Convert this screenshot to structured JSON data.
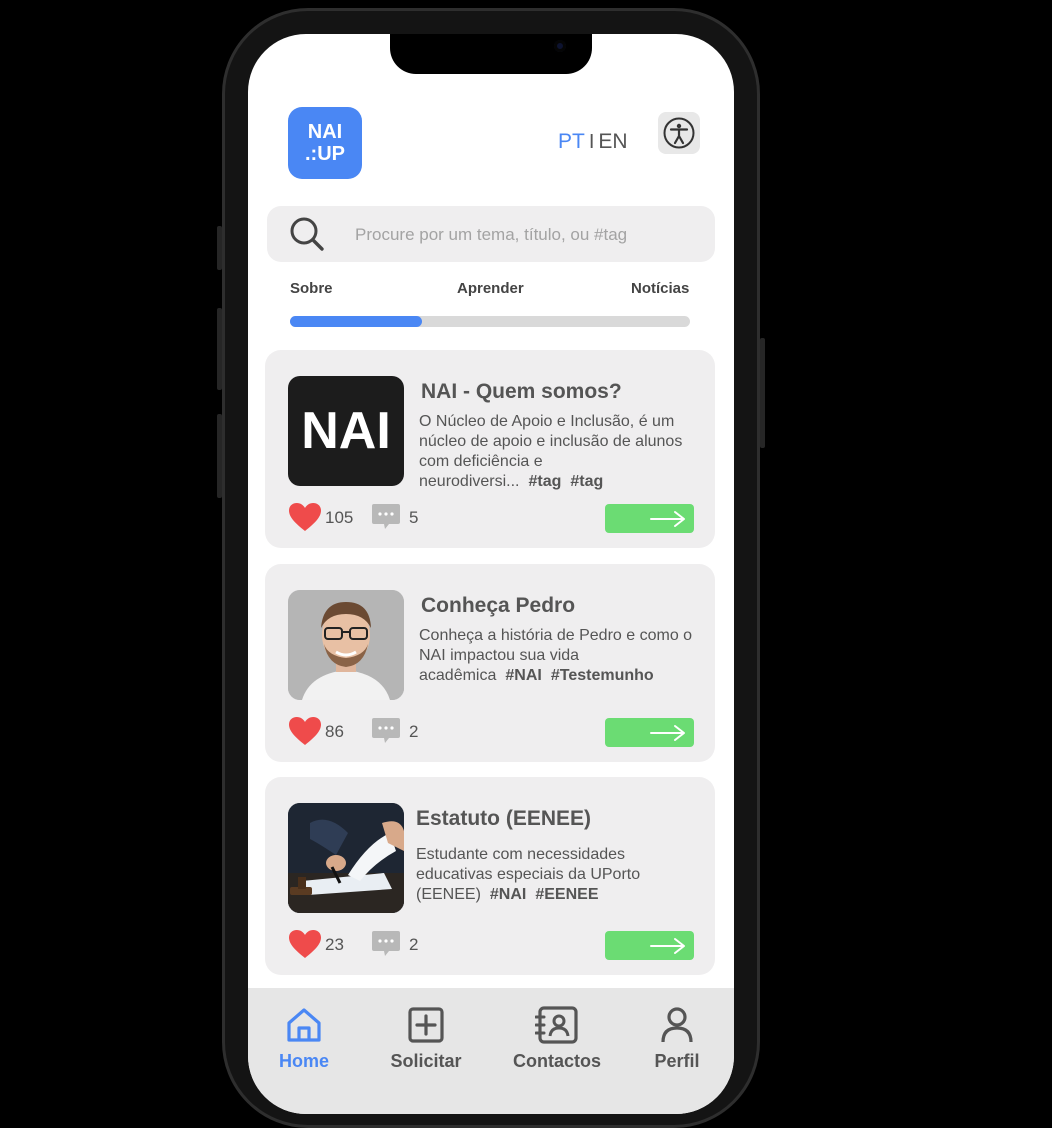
{
  "brand": {
    "logo_line1": "NAI",
    "logo_line2": ".:UP",
    "accent_color": "#4a87f4",
    "action_color": "#6bdc73"
  },
  "language": {
    "selected": "PT",
    "separator": "I",
    "other": "EN"
  },
  "accessibility": {
    "icon": "accessibility-icon"
  },
  "search": {
    "icon": "search-icon",
    "placeholder": "Procure por um tema, título, ou #tag",
    "value": ""
  },
  "tabs": [
    {
      "label": "Sobre"
    },
    {
      "label": "Aprender"
    },
    {
      "label": "Notícias"
    }
  ],
  "tab_progress": 0.33,
  "cards": [
    {
      "thumb_text": "NAI",
      "title": "NAI - Quem somos?",
      "description": "O Núcleo de Apoio e Inclusão, é um núcleo de apoio e inclusão de alunos com deficiência e neurodiversi...",
      "tags": [
        "#tag",
        "#tag"
      ],
      "likes": "105",
      "comments": "5"
    },
    {
      "thumb_text": "",
      "title": "Conheça Pedro",
      "description": "Conheça a história de Pedro e como o NAI impactou sua vida acadêmica",
      "tags": [
        "#NAI",
        "#Testemunho"
      ],
      "likes": "86",
      "comments": "2"
    },
    {
      "thumb_text": "",
      "title": "Estatuto (EENEE)",
      "description": "Estudante com necessidades educativas especiais da UPorto (EENEE)",
      "tags": [
        "#NAI",
        "#EENEE"
      ],
      "likes": "23",
      "comments": "2"
    }
  ],
  "bottom_nav": [
    {
      "label": "Home",
      "icon": "home-icon",
      "active": true
    },
    {
      "label": "Solicitar",
      "icon": "add-square-icon",
      "active": false
    },
    {
      "label": "Contactos",
      "icon": "contacts-book-icon",
      "active": false
    },
    {
      "label": "Perfil",
      "icon": "user-icon",
      "active": false
    }
  ]
}
